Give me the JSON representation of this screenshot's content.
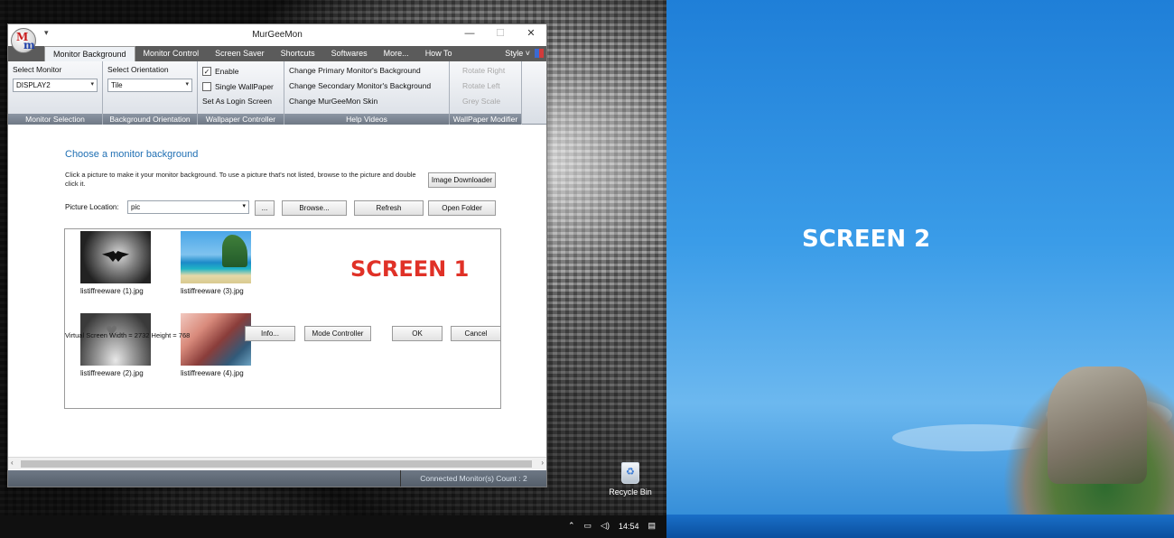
{
  "app": {
    "title": "MurGeeMon",
    "logo_letters": [
      "M",
      "m"
    ],
    "quick_access": "▾",
    "controls": [
      "—",
      "☐",
      "✕"
    ]
  },
  "tabs": [
    "Monitor Background",
    "Monitor Control",
    "Screen Saver",
    "Shortcuts",
    "Softwares",
    "More...",
    "How To"
  ],
  "style_menu": "Style ˅",
  "ribbon": {
    "monitor_selection": {
      "label": "Select Monitor",
      "value": "DISPLAY2",
      "footer": "Monitor Selection"
    },
    "background_orientation": {
      "label": "Select Orientation",
      "value": "Tile",
      "footer": "Background Orientation"
    },
    "wallpaper_controller": {
      "enable": "Enable",
      "enable_checked": true,
      "single": "Single WallPaper",
      "single_checked": false,
      "login": "Set As Login Screen",
      "footer": "Wallpaper Controller"
    },
    "help_videos": {
      "items": [
        "Change Primary Monitor's Background",
        "Change Secondary Monitor's Background",
        "Change MurGeeMon Skin"
      ],
      "footer": "Help Videos"
    },
    "wallpaper_modifier": {
      "items": [
        "Rotate Right",
        "Rotate Left",
        "Grey Scale"
      ],
      "footer": "WallPaper Modifier"
    }
  },
  "content": {
    "heading": "Choose a monitor background",
    "description": "Click a picture to make it your monitor background. To use a picture that's not listed, browse to the picture and double click it.",
    "image_downloader": "Image Downloader",
    "picture_location_label": "Picture Location:",
    "picture_location_value": "pic",
    "dots_button": "...",
    "browse_button": "Browse...",
    "refresh_button": "Refresh",
    "open_folder_button": "Open Folder",
    "thumbnails": [
      {
        "caption": "listiffreeware (1).jpg"
      },
      {
        "caption": "listiffreeware (3).jpg"
      },
      {
        "caption": "listiffreeware (2).jpg"
      },
      {
        "caption": "listiffreeware (4).jpg"
      }
    ],
    "screen1_label": "SCREEN 1",
    "virtual_screen": "Virtual Screen Width = 2732 Height = 768",
    "info_button": "Info...",
    "mode_controller_button": "Mode Controller",
    "ok_button": "OK",
    "cancel_button": "Cancel"
  },
  "statusbar": {
    "count": "Connected Monitor(s) Count : 2"
  },
  "desktop": {
    "recycle_bin": "Recycle Bin",
    "clock": "14:54",
    "tray_icons": [
      "chevron-up-icon",
      "network-icon",
      "volume-icon",
      "notification-icon"
    ],
    "screen2_label": "SCREEN 2"
  },
  "colors": {
    "accent_blue": "#1f6fb3",
    "screen1_label": "#e03127",
    "tab_bar": "#5b5b5b",
    "ribbon_footer": "#6f7885"
  }
}
